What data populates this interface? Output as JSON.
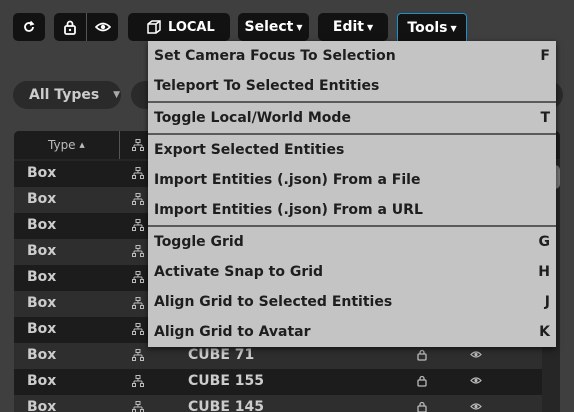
{
  "toolbar": {
    "mode_label": "LOCAL",
    "select_label": "Select",
    "edit_label": "Edit",
    "tools_label": "Tools"
  },
  "filter": {
    "all_types_label": "All Types"
  },
  "table": {
    "col_type": "Type",
    "rows": [
      {
        "type": "Box",
        "name": ""
      },
      {
        "type": "Box",
        "name": ""
      },
      {
        "type": "Box",
        "name": ""
      },
      {
        "type": "Box",
        "name": ""
      },
      {
        "type": "Box",
        "name": ""
      },
      {
        "type": "Box",
        "name": ""
      },
      {
        "type": "Box",
        "name": ""
      },
      {
        "type": "Box",
        "name": "CUBE 71"
      },
      {
        "type": "Box",
        "name": "CUBE 155"
      },
      {
        "type": "Box",
        "name": "CUBE 145"
      }
    ]
  },
  "tools_menu": {
    "items": [
      {
        "label": "Set Camera Focus To Selection",
        "key": "F"
      },
      {
        "label": "Teleport To Selected Entities",
        "key": ""
      },
      {
        "label": "Toggle Local/World Mode",
        "key": "T"
      },
      {
        "label": "Export Selected Entities",
        "key": ""
      },
      {
        "label": "Import Entities (.json) From a File",
        "key": ""
      },
      {
        "label": "Import Entities (.json) From a URL",
        "key": ""
      },
      {
        "label": "Toggle Grid",
        "key": "G"
      },
      {
        "label": "Activate Snap to Grid",
        "key": "H"
      },
      {
        "label": "Align Grid to Selected Entities",
        "key": "J"
      },
      {
        "label": "Align Grid to Avatar",
        "key": "K"
      }
    ]
  },
  "colors": {
    "background": "#3f3f3f",
    "toolbar_button": "#121212",
    "menu_background": "#c4c4c4",
    "tools_button_border": "#1f8fcf",
    "row_dark": "#1c1c1c",
    "row_light": "#2e2e2e"
  },
  "icons": [
    "refresh-icon",
    "lock-icon",
    "eye-icon",
    "cube-icon",
    "network-icon",
    "sort-caret-icon",
    "chevron-down-icon"
  ]
}
